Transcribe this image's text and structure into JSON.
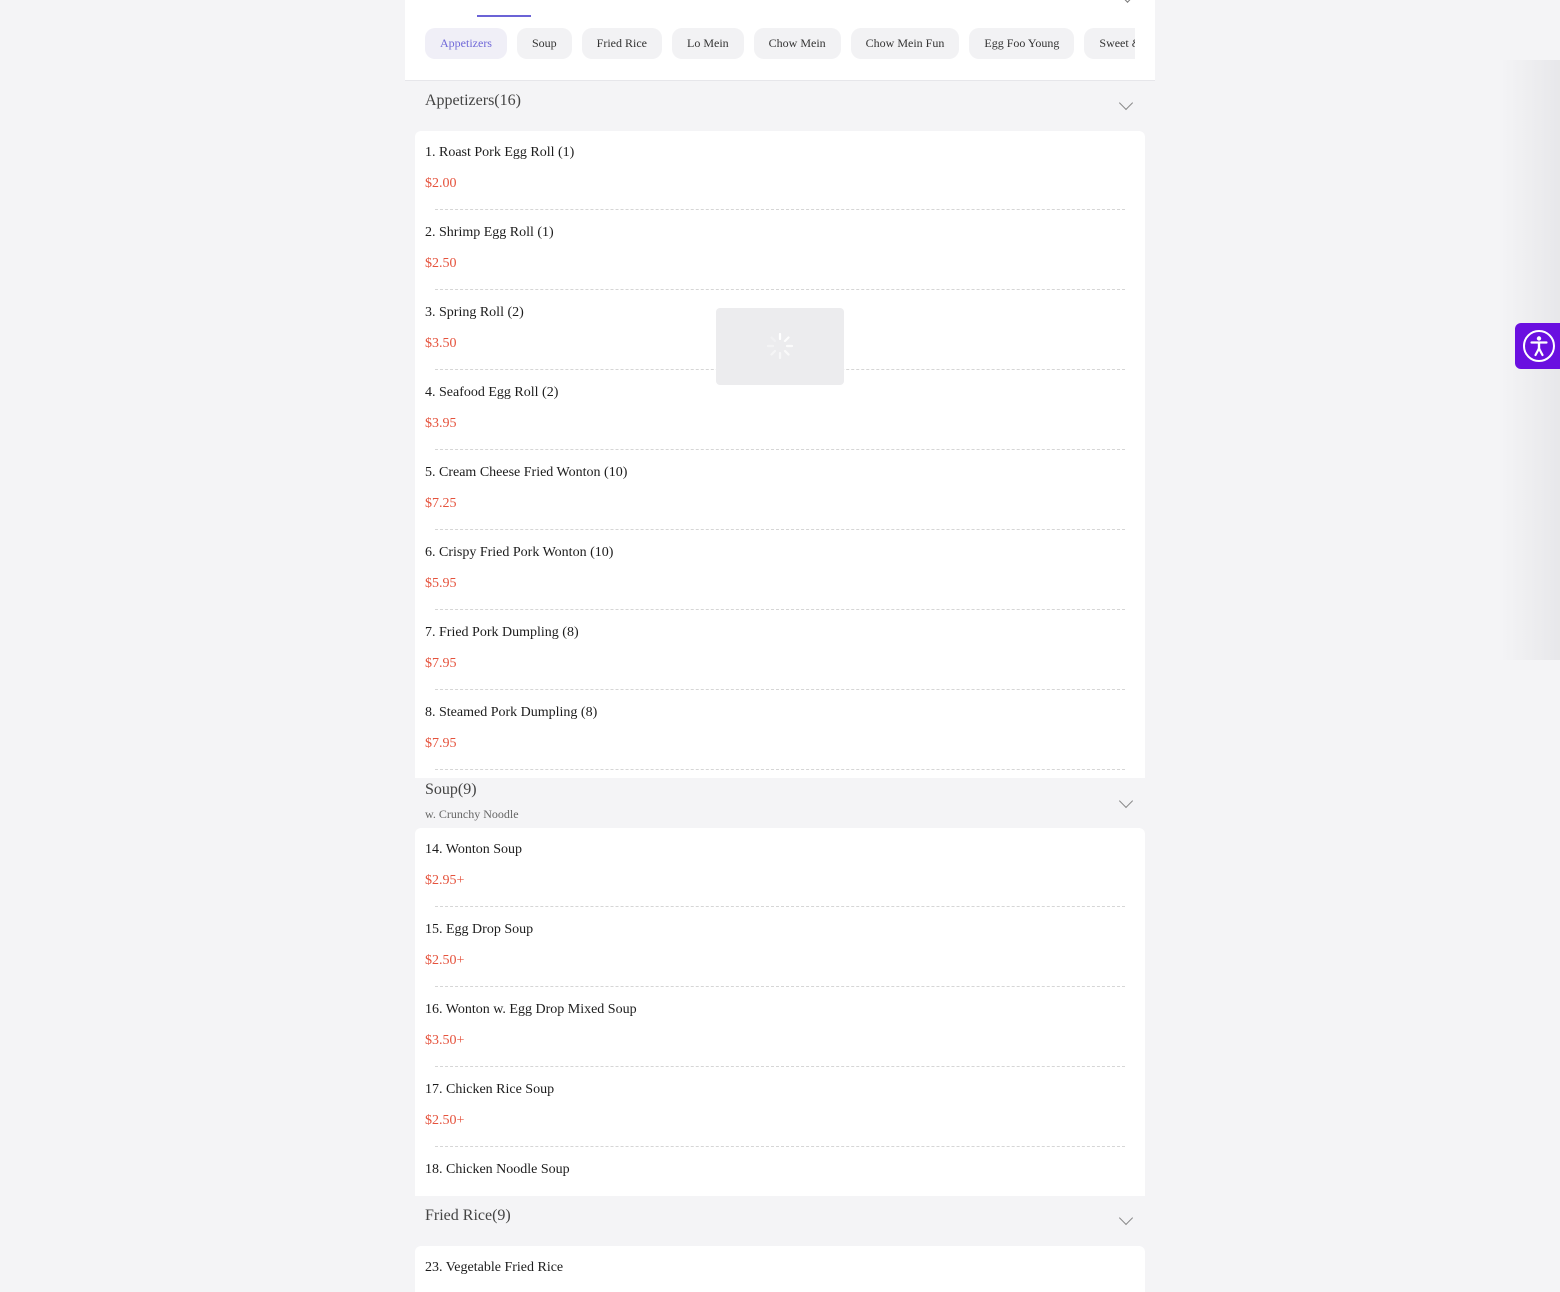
{
  "tabs": {
    "chips": [
      {
        "label": "Appetizers",
        "active": true
      },
      {
        "label": "Soup"
      },
      {
        "label": "Fried Rice"
      },
      {
        "label": "Lo Mein"
      },
      {
        "label": "Chow Mein"
      },
      {
        "label": "Chow Mein Fun"
      },
      {
        "label": "Egg Foo Young"
      },
      {
        "label": "Sweet &"
      }
    ]
  },
  "sections": [
    {
      "title": "Appetizers(16)",
      "subtitle": "",
      "items": [
        {
          "name": "1. Roast Pork Egg Roll (1)",
          "price": "$2.00"
        },
        {
          "name": "2. Shrimp Egg Roll (1)",
          "price": "$2.50"
        },
        {
          "name": "3. Spring Roll (2)",
          "price": "$3.50"
        },
        {
          "name": "4. Seafood Egg Roll (2)",
          "price": "$3.95"
        },
        {
          "name": "5. Cream Cheese Fried Wonton (10)",
          "price": "$7.25"
        },
        {
          "name": "6. Crispy Fried Pork Wonton (10)",
          "price": "$5.95"
        },
        {
          "name": "7. Fried Pork Dumpling (8)",
          "price": "$7.95"
        },
        {
          "name": "8. Steamed Pork Dumpling (8)",
          "price": "$7.95"
        }
      ]
    },
    {
      "title": "Soup(9)",
      "subtitle": "w. Crunchy Noodle",
      "items": [
        {
          "name": "14. Wonton Soup",
          "price": "$2.95+"
        },
        {
          "name": "15. Egg Drop Soup",
          "price": "$2.50+"
        },
        {
          "name": "16. Wonton w. Egg Drop Mixed Soup",
          "price": "$3.50+"
        },
        {
          "name": "17. Chicken Rice Soup",
          "price": "$2.50+"
        },
        {
          "name": "18. Chicken Noodle Soup",
          "price": ""
        }
      ]
    },
    {
      "title": "Fried Rice(9)",
      "subtitle": "",
      "items": [
        {
          "name": "23. Vegetable Fried Rice",
          "price": ""
        }
      ]
    }
  ],
  "colors": {
    "accent": "#6b63d6",
    "price": "#e5533d",
    "accessibility": "#6a0fe0"
  },
  "icons": {
    "loader": "loading-spinner-icon",
    "accessibility": "accessibility-icon",
    "expand": "chevron-down-icon"
  }
}
